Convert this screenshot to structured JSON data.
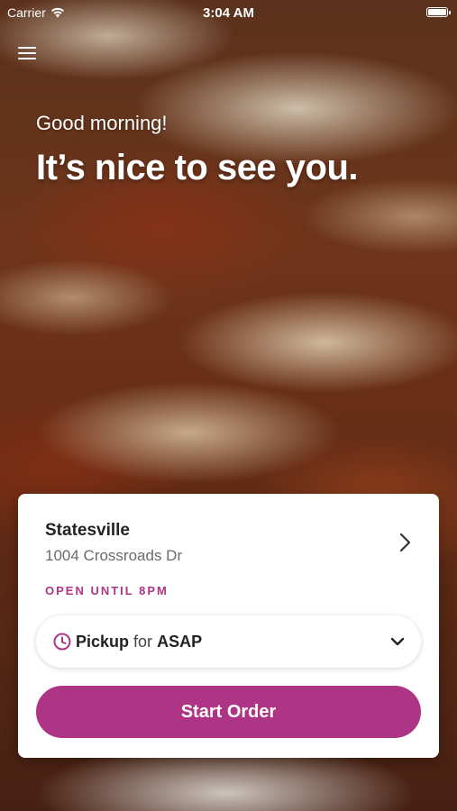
{
  "status_bar": {
    "carrier": "Carrier",
    "time": "3:04 AM"
  },
  "header": {
    "greeting": "Good morning!",
    "headline": "It’s nice to see you."
  },
  "store": {
    "name": "Statesville",
    "address": "1004 Crossroads Dr",
    "hours": "OPEN UNTIL 8PM"
  },
  "order_mode": {
    "mode": "Pickup",
    "connector": "for",
    "time": "ASAP"
  },
  "actions": {
    "start_order": "Start Order"
  },
  "colors": {
    "accent": "#ae3585",
    "text_dark": "#222222",
    "text_muted": "#6b6b6b"
  },
  "icons": [
    "wifi-icon",
    "battery-icon",
    "menu-icon",
    "chevron-right-icon",
    "clock-icon",
    "chevron-down-icon"
  ]
}
